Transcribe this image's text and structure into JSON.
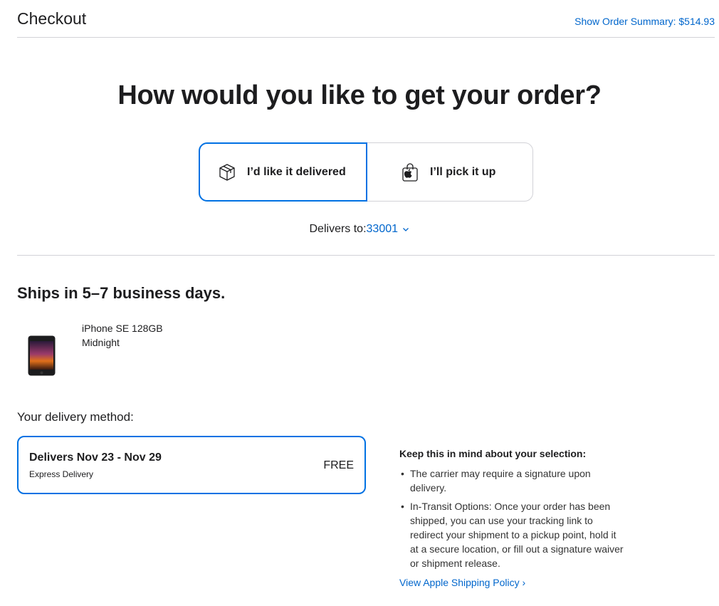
{
  "header": {
    "title": "Checkout",
    "order_summary_link": "Show Order Summary: $514.93"
  },
  "fulfillment": {
    "headline": "How would you like to get your order?",
    "options": [
      {
        "label": "I’d like it delivered",
        "icon": "box-icon",
        "selected": true
      },
      {
        "label": "I’ll pick it up",
        "icon": "apple-bag-icon",
        "selected": false
      }
    ],
    "delivers_to_label": "Delivers to:",
    "zip": "33001",
    "zip_icon": "chevron-down-icon"
  },
  "shipment": {
    "title": "Ships in 5–7 business days.",
    "product": {
      "name": "iPhone SE 128GB",
      "color": "Midnight",
      "image": "iphone-se-midnight"
    }
  },
  "delivery_method": {
    "title": "Your delivery method:",
    "selected": {
      "date": "Delivers Nov 23 - Nov 29",
      "type": "Express Delivery",
      "price": "FREE"
    }
  },
  "notes": {
    "title": "Keep this in mind about your selection:",
    "items": [
      "The carrier may require a signature upon delivery.",
      "In-Transit Options: Once your order has been shipped, you can use your tracking link to redirect your shipment to a pickup point, hold it at a secure location, or fill out a signature waiver or shipment release."
    ],
    "policy_link": "View Apple Shipping Policy ›"
  },
  "colors": {
    "accent": "#0071e3",
    "link": "#0066cc",
    "text": "#1d1d1f",
    "divider": "#d2d2d7"
  }
}
